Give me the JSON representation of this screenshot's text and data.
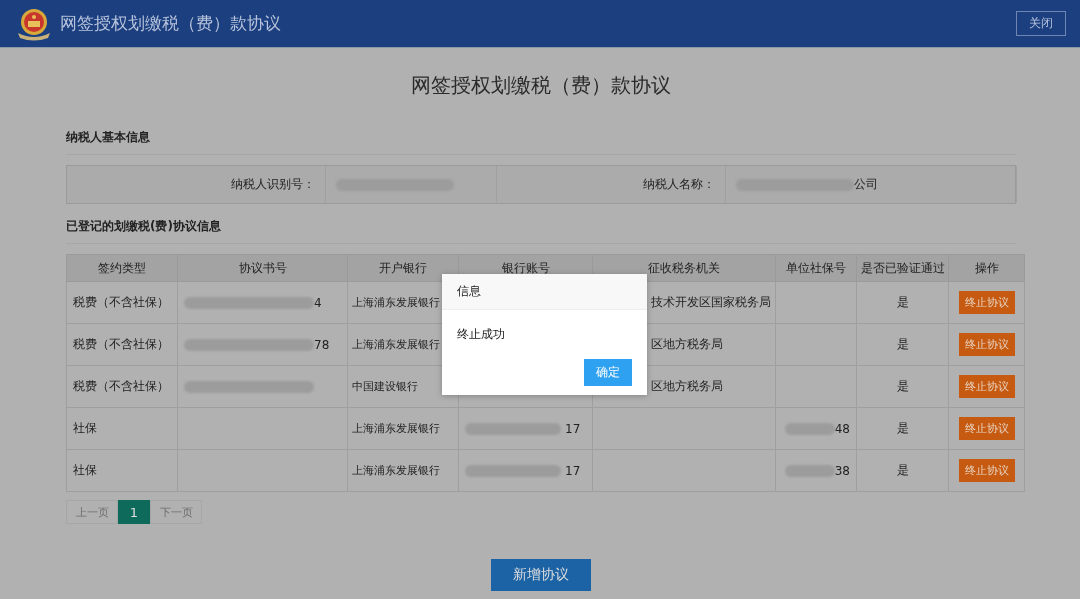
{
  "header": {
    "title": "网签授权划缴税（费）款协议",
    "close_button": "关闭"
  },
  "page_title": "网签授权划缴税（费）款协议",
  "basic_info": {
    "heading": "纳税人基本信息",
    "fields": [
      {
        "label": "纳税人识别号：",
        "redacted": true
      },
      {
        "label": "纳税人名称：",
        "value": "公司",
        "redacted": true
      }
    ]
  },
  "agreements": {
    "heading": "已登记的划缴税(费)协议信息",
    "columns": [
      "签约类型",
      "协议书号",
      "开户银行",
      "银行账号",
      "征收税务机关",
      "单位社保号",
      "是否已验证通过",
      "操作"
    ],
    "rows": [
      {
        "type": "税费（不含社保）",
        "agreement_no": {
          "value": "4",
          "redacted": true
        },
        "bank": "上海浦东发展银行",
        "tax_authority": {
          "value": "技术开发区国家税务局",
          "covered": true
        },
        "verified": "是",
        "action": "终止协议"
      },
      {
        "type": "税费（不含社保）",
        "agreement_no": {
          "value": "78",
          "redacted": true
        },
        "bank": "上海浦东发展银行",
        "tax_authority": {
          "value": "区地方税务局",
          "covered": true
        },
        "verified": "是",
        "action": "终止协议"
      },
      {
        "type": "税费（不含社保）",
        "agreement_no": {
          "redacted": true
        },
        "bank": "中国建设银行",
        "tax_authority": {
          "value": "区地方税务局",
          "covered": true
        },
        "verified": "是",
        "action": "终止协议"
      },
      {
        "type": "社保",
        "bank": "上海浦东发展银行",
        "account": {
          "value": "17",
          "redacted": true
        },
        "social_security_no": {
          "value": "48",
          "redacted": true
        },
        "verified": "是",
        "action": "终止协议"
      },
      {
        "type": "社保",
        "bank": "上海浦东发展银行",
        "account": {
          "value": "17",
          "redacted": true
        },
        "social_security_no": {
          "value": "38",
          "redacted": true
        },
        "verified": "是",
        "action": "终止协议"
      }
    ]
  },
  "pagination": [
    {
      "label": "上一页",
      "selected": false,
      "disabled": true
    },
    {
      "label": "1",
      "selected": true,
      "disabled": false
    },
    {
      "label": "下一页",
      "selected": false,
      "disabled": true
    }
  ],
  "add_button": "新增协议",
  "dialog": {
    "title": "信息",
    "message": "终止成功",
    "ok_button": "确定"
  }
}
